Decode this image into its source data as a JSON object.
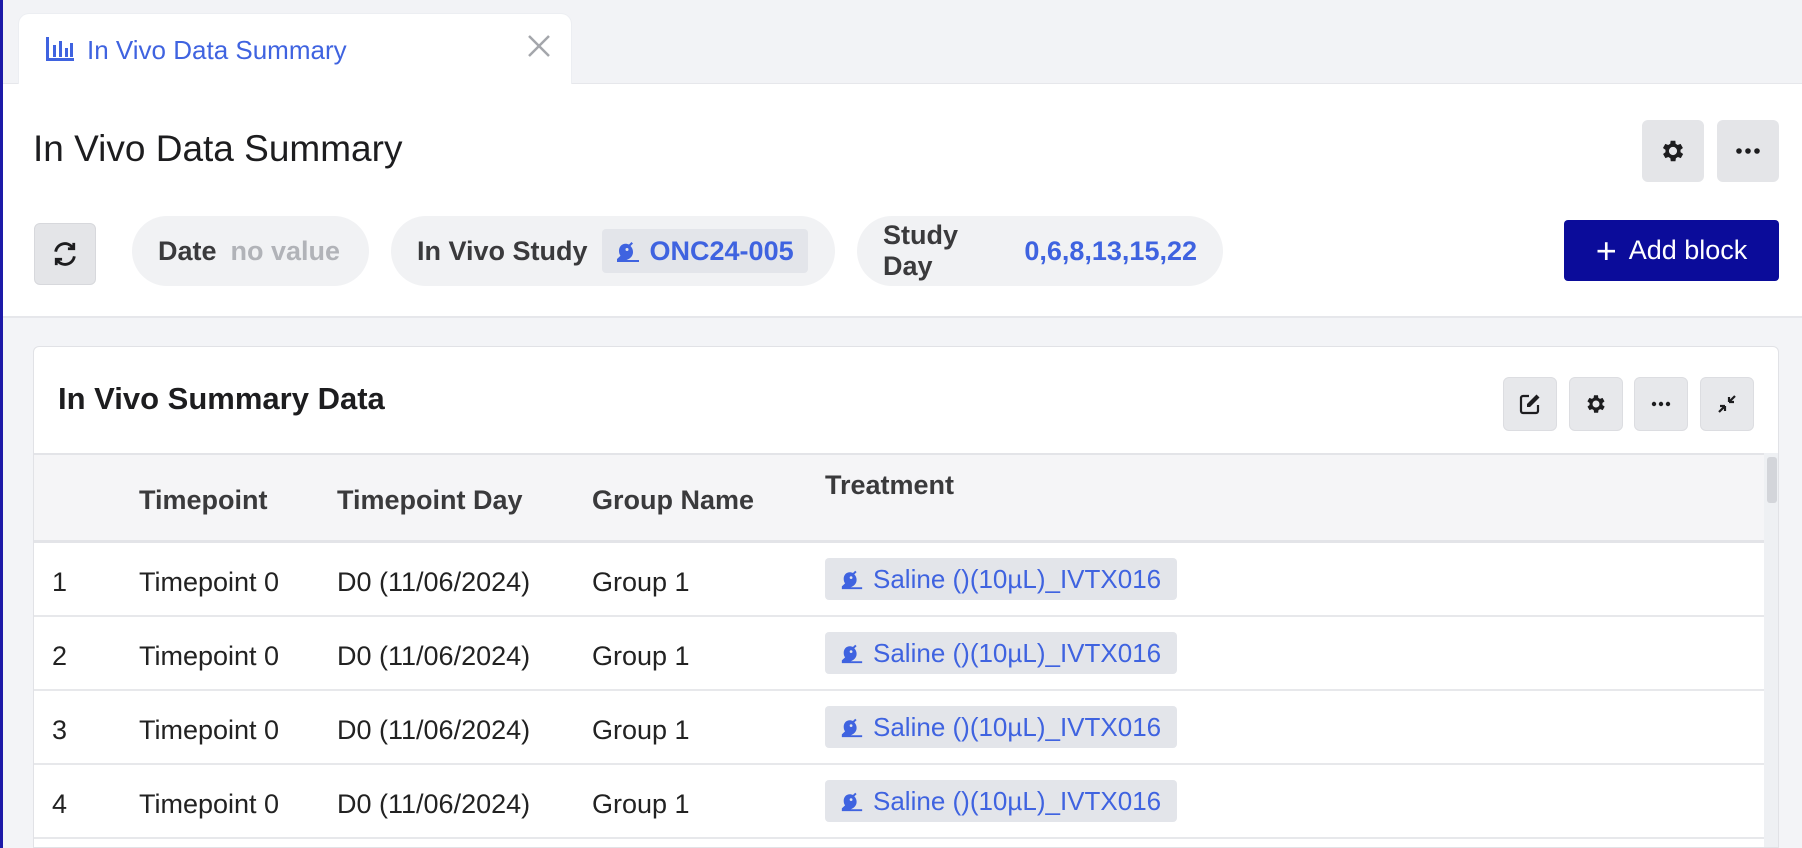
{
  "tab": {
    "label": "In Vivo Data Summary",
    "icon": "bar-chart-icon"
  },
  "page": {
    "title": "In Vivo Data Summary"
  },
  "filters": {
    "date": {
      "label": "Date",
      "value": "no value"
    },
    "study": {
      "label": "In Vivo Study",
      "value": "ONC24-005"
    },
    "study_day": {
      "label": "Study Day",
      "value": "0,6,8,13,15,22"
    }
  },
  "add_block_label": "Add block",
  "card": {
    "title": "In Vivo Summary Data"
  },
  "table": {
    "columns": [
      "Timepoint",
      "Timepoint Day",
      "Group Name",
      "Treatment"
    ],
    "rows": [
      {
        "idx": "1",
        "timepoint": "Timepoint 0",
        "day": "D0 (11/06/2024)",
        "group": "Group 1",
        "treatment": "Saline ()(10µL)_IVTX016"
      },
      {
        "idx": "2",
        "timepoint": "Timepoint 0",
        "day": "D0 (11/06/2024)",
        "group": "Group 1",
        "treatment": "Saline ()(10µL)_IVTX016"
      },
      {
        "idx": "3",
        "timepoint": "Timepoint 0",
        "day": "D0 (11/06/2024)",
        "group": "Group 1",
        "treatment": "Saline ()(10µL)_IVTX016"
      },
      {
        "idx": "4",
        "timepoint": "Timepoint 0",
        "day": "D0 (11/06/2024)",
        "group": "Group 1",
        "treatment": "Saline ()(10µL)_IVTX016"
      }
    ]
  },
  "colors": {
    "accent": "#3f63e0",
    "primary_button": "#0b0c9a",
    "chip_bg": "#e3e5ea"
  }
}
